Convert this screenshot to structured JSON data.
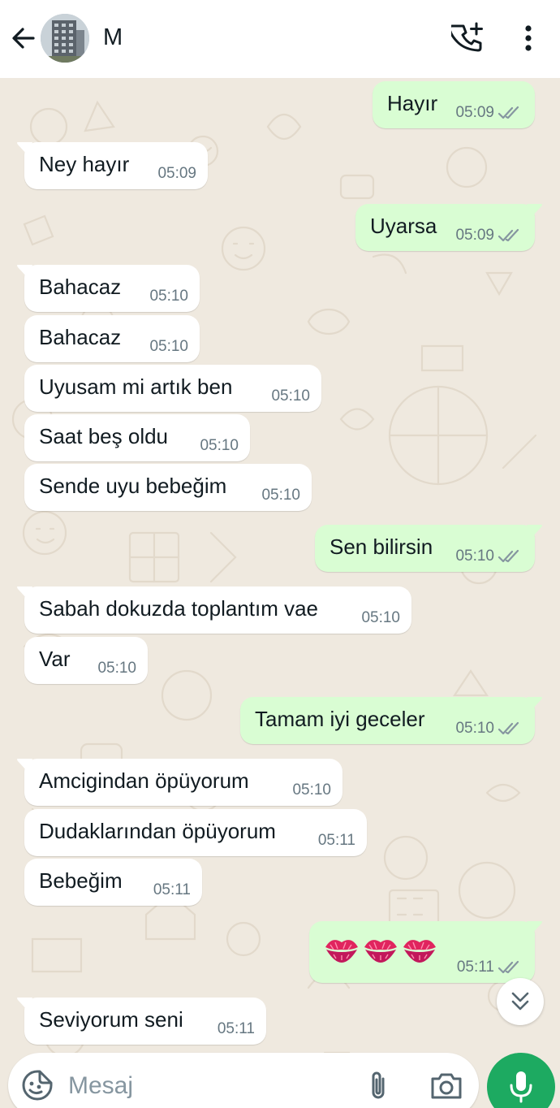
{
  "header": {
    "contact_name": "M"
  },
  "messages": [
    {
      "dir": "out",
      "text": "Hayır",
      "time": "05:09"
    },
    {
      "dir": "in",
      "text": "Ney hayır",
      "time": "05:09"
    },
    {
      "dir": "out",
      "text": "Uyarsa",
      "time": "05:09"
    },
    {
      "dir": "in",
      "text": "Bahacaz",
      "time": "05:10"
    },
    {
      "dir": "in",
      "text": "Bahacaz",
      "time": "05:10"
    },
    {
      "dir": "in",
      "text": "Uyusam mi artık ben",
      "time": "05:10"
    },
    {
      "dir": "in",
      "text": "Saat beş oldu",
      "time": "05:10"
    },
    {
      "dir": "in",
      "text": "Sende uyu bebeğim",
      "time": "05:10"
    },
    {
      "dir": "out",
      "text": "Sen bilirsin",
      "time": "05:10"
    },
    {
      "dir": "in",
      "text": "Sabah dokuzda toplantım vae",
      "time": "05:10"
    },
    {
      "dir": "in",
      "text": "Var",
      "time": "05:10"
    },
    {
      "dir": "out",
      "text": "Tamam iyi geceler",
      "time": "05:10"
    },
    {
      "dir": "in",
      "text": "Amcigindan öpüyorum",
      "time": "05:10"
    },
    {
      "dir": "in",
      "text": "Dudaklarından öpüyorum",
      "time": "05:11"
    },
    {
      "dir": "in",
      "text": "Bebeğim",
      "time": "05:11"
    },
    {
      "dir": "out",
      "text": "",
      "emoji": [
        "kiss-mark-icon",
        "kiss-mark-icon",
        "kiss-mark-icon"
      ],
      "time": "05:11"
    },
    {
      "dir": "in",
      "text": "Seviyorum seni",
      "time": "05:11"
    }
  ],
  "composer": {
    "placeholder": "Mesaj"
  },
  "icons": {
    "back": "arrow-left-icon",
    "call": "phone-add-icon",
    "menu": "more-vertical-icon",
    "scroll": "double-chevron-down-icon",
    "sticker": "sticker-icon",
    "attach": "paperclip-icon",
    "camera": "camera-icon",
    "mic": "microphone-icon"
  },
  "colors": {
    "outgoing_bubble": "#d9fdd3",
    "incoming_bubble": "#ffffff",
    "accent": "#1daa61",
    "read_ticks": "#8696a0",
    "lips": "#e0245e"
  }
}
